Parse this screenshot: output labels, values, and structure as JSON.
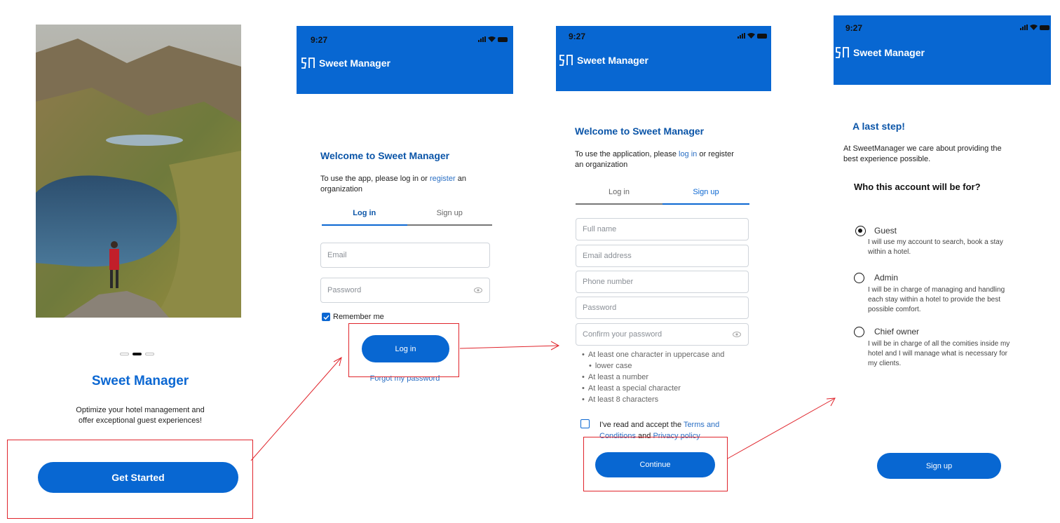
{
  "screen1": {
    "app_title": "Sweet Manager",
    "tagline_line1": "Optimize your hotel management and",
    "tagline_line2": "offer exceptional guest experiences!",
    "get_started_label": "Get Started"
  },
  "status": {
    "time": "9:27"
  },
  "brand": {
    "name": "Sweet Manager"
  },
  "login": {
    "title": "Welcome to Sweet Manager",
    "intro_prefix": "To use the app, please log in or ",
    "intro_link": "register",
    "intro_suffix": " an",
    "intro_line2": "organization",
    "tab_login": "Log in",
    "tab_signup": "Sign up",
    "email_placeholder": "Email",
    "password_placeholder": "Password",
    "remember_label": "Remember me",
    "login_button": "Log in",
    "forgot_link": "Forgot my password"
  },
  "signup": {
    "title": "Welcome to Sweet Manager",
    "intro_prefix": "To use the application, please ",
    "intro_link": "log in",
    "intro_suffix": " or register",
    "intro_line2": "an organization",
    "tab_login": "Log in",
    "tab_signup": "Sign up",
    "full_name_placeholder": "Full name",
    "email_placeholder": "Email address",
    "phone_placeholder": "Phone number",
    "password_placeholder": "Password",
    "confirm_placeholder": "Confirm your password",
    "rules": [
      "At least one character in uppercase and",
      "lower case",
      "At least a number",
      "At least a special character",
      "At least 8 characters"
    ],
    "terms_prefix": "I've read and accept the ",
    "terms_link": "Terms and",
    "terms_link2": "Conditions",
    "terms_and": " and ",
    "privacy_link": "Privacy policy",
    "continue_button": "Continue"
  },
  "role": {
    "title": "A last step!",
    "intro_line1": "At SweetManager we care about providing the",
    "intro_line2": "best experience possible.",
    "question": "Who this account will be for?",
    "options": [
      {
        "label": "Guest",
        "desc1": "I will use my account to search, book a stay",
        "desc2": "within a hotel.",
        "desc3": ""
      },
      {
        "label": "Admin",
        "desc1": "I will be in charge of managing and handling",
        "desc2": "each stay within a hotel to provide the best",
        "desc3": "possible comfort."
      },
      {
        "label": "Chief owner",
        "desc1": "I will be in charge of all the comities inside my",
        "desc2": "hotel and I will manage what is necessary for",
        "desc3": "my clients."
      }
    ],
    "signup_button": "Sign up"
  },
  "colors": {
    "brand_blue": "#0867d2",
    "title_blue": "#0b55a8",
    "annotation_red": "#e0252c"
  }
}
